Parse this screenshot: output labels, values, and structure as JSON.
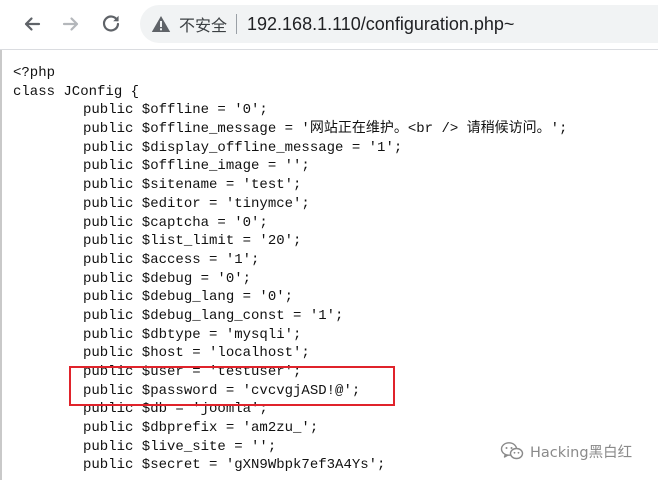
{
  "browser": {
    "back_icon": "arrow-left-icon",
    "forward_icon": "arrow-right-icon",
    "reload_icon": "reload-icon",
    "security_icon": "warning-triangle-icon",
    "security_label": "不安全",
    "url": "192.168.1.110/configuration.php~"
  },
  "code": {
    "lines": [
      "<?php",
      "class JConfig {",
      "public $offline = '0';",
      "public $offline_message = '网站正在维护。<br /> 请稍候访问。';",
      "public $display_offline_message = '1';",
      "public $offline_image = '';",
      "public $sitename = 'test';",
      "public $editor = 'tinymce';",
      "public $captcha = '0';",
      "public $list_limit = '20';",
      "public $access = '1';",
      "public $debug = '0';",
      "public $debug_lang = '0';",
      "public $debug_lang_const = '1';",
      "public $dbtype = 'mysqli';",
      "public $host = 'localhost';",
      "public $user = 'testuser';",
      "public $password = 'cvcvgjASD!@';",
      "public $db = 'joomla';",
      "public $dbprefix = 'am2zu_';",
      "public $live_site = '';",
      "public $secret = 'gXN9Wbpk7ef3A4Ys';"
    ]
  },
  "annotation": {
    "color": "#e0232b"
  },
  "watermark": {
    "icon": "wechat-icon",
    "text": "Hacking黑白红"
  }
}
